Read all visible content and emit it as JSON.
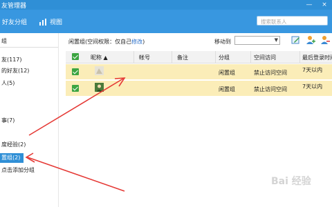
{
  "window": {
    "title": "友管理器",
    "minimize_glyph": "—",
    "close_glyph": "×"
  },
  "toolbar": {
    "add_group_label": "好友分组",
    "view_label": "视图",
    "search_placeholder": "搜索联系人"
  },
  "sidebar": {
    "header": "组",
    "groups": [
      {
        "label": "友(117)"
      },
      {
        "label": "的好友(12)"
      },
      {
        "label": "人(5)"
      },
      {
        "label": "事(7)"
      },
      {
        "label": "度经验(2)"
      },
      {
        "label": "置组(2)",
        "selected": true
      },
      {
        "label": "点击添加分组"
      }
    ]
  },
  "main": {
    "group_info_prefix": "闲置组(空间权限：仅自己",
    "group_info_edit": "修改",
    "group_info_suffix": ")",
    "move_label": "移动到",
    "move_value": "",
    "columns": [
      "昵称 ▲",
      "帐号",
      "备注",
      "分组",
      "空间访问",
      "最后登录时间"
    ],
    "rows": [
      {
        "nickname": "",
        "account": "",
        "note": "",
        "group": "闲置组",
        "space": "禁止访问空间",
        "last_login": "7天以内"
      },
      {
        "nickname": "",
        "account": "",
        "note": "",
        "group": "闲置组",
        "space": "禁止访问空间",
        "last_login": "7天以内"
      }
    ]
  },
  "watermark": {
    "text": "Bai 经验"
  },
  "colors": {
    "titlebar": "#2f8fd6",
    "toolbar": "#3897e0",
    "row_highlight": "#fbedb8",
    "arrow": "#e53935",
    "checkbox": "#3ca542"
  }
}
